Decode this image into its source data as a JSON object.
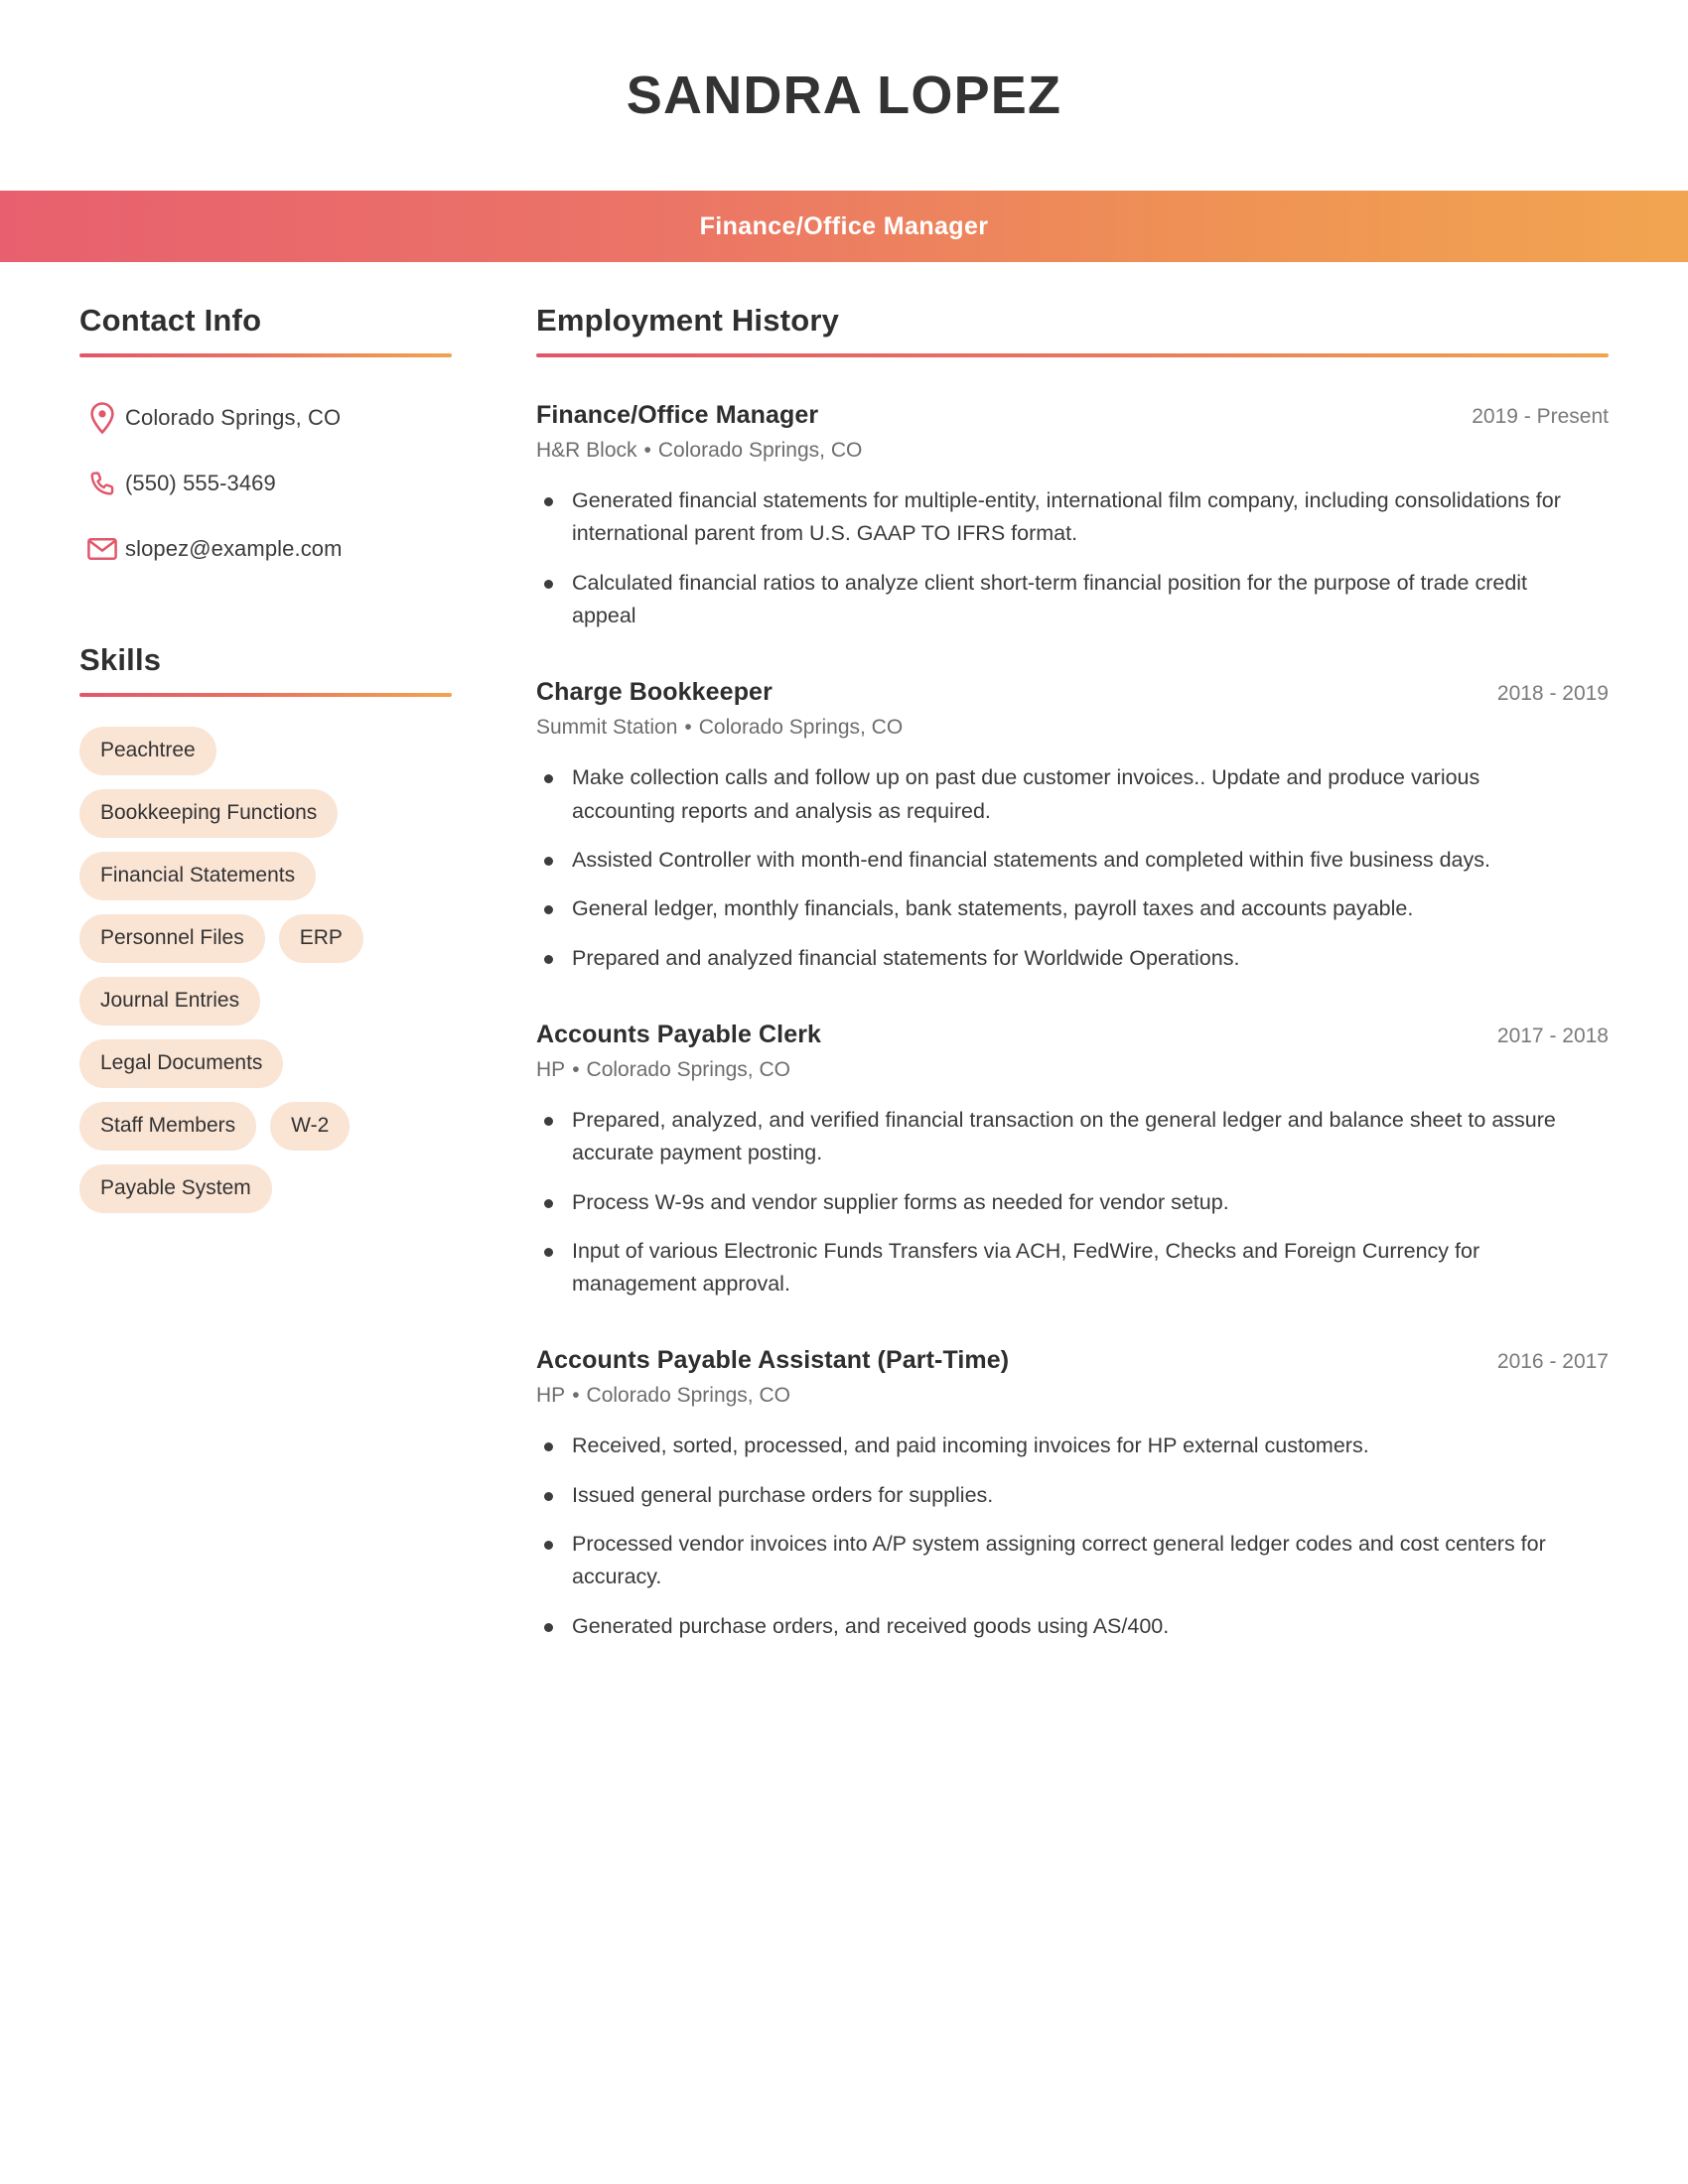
{
  "header": {
    "name": "SANDRA LOPEZ",
    "title": "Finance/Office Manager",
    "accent_left": "#e8606f",
    "accent_right": "#f2a550"
  },
  "sidebar": {
    "contact": {
      "heading": "Contact Info",
      "items": [
        {
          "icon": "location-pin-icon",
          "value": "Colorado Springs, CO"
        },
        {
          "icon": "phone-icon",
          "value": "(550) 555-3469"
        },
        {
          "icon": "envelope-icon",
          "value": "slopez@example.com"
        }
      ]
    },
    "skills": {
      "heading": "Skills",
      "pill_color": "#fae4d4",
      "items": [
        "Peachtree",
        "Bookkeeping Functions",
        "Financial Statements",
        "Personnel Files",
        "ERP",
        "Journal Entries",
        "Legal Documents",
        "Staff Members",
        "W-2",
        "Payable System"
      ]
    }
  },
  "main": {
    "employment": {
      "heading": "Employment History",
      "jobs": [
        {
          "title": "Finance/Office Manager",
          "dates": "2019 - Present",
          "company": "H&R Block",
          "location": "Colorado Springs, CO",
          "bullets": [
            "Generated financial statements for multiple-entity, international film company, including consolidations for international parent from U.S. GAAP TO IFRS format.",
            "Calculated financial ratios to analyze client short-term financial position for the purpose of trade credit appeal"
          ]
        },
        {
          "title": "Charge Bookkeeper",
          "dates": "2018 - 2019",
          "company": "Summit Station",
          "location": "Colorado Springs, CO",
          "bullets": [
            "Make collection calls and follow up on past due customer invoices.. Update and produce various accounting reports and analysis as required.",
            "Assisted Controller with month-end financial statements and completed within five business days.",
            "General ledger, monthly financials, bank statements, payroll taxes and accounts payable.",
            "Prepared and analyzed financial statements for Worldwide Operations."
          ]
        },
        {
          "title": "Accounts Payable Clerk",
          "dates": "2017 - 2018",
          "company": "HP",
          "location": "Colorado Springs, CO",
          "bullets": [
            "Prepared, analyzed, and verified financial transaction on the general ledger and balance sheet to assure accurate payment posting.",
            "Process W-9s and vendor supplier forms as needed for vendor setup.",
            "Input of various Electronic Funds Transfers via ACH, FedWire, Checks and Foreign Currency for management approval."
          ]
        },
        {
          "title": "Accounts Payable Assistant (Part-Time)",
          "dates": "2016 - 2017",
          "company": "HP",
          "location": "Colorado Springs, CO",
          "bullets": [
            "Received, sorted, processed, and paid incoming invoices for HP external customers.",
            "Issued general purchase orders for supplies.",
            "Processed vendor invoices into A/P system assigning correct general ledger codes and cost centers for accuracy.",
            "Generated purchase orders, and received goods using AS/400."
          ]
        }
      ]
    }
  }
}
